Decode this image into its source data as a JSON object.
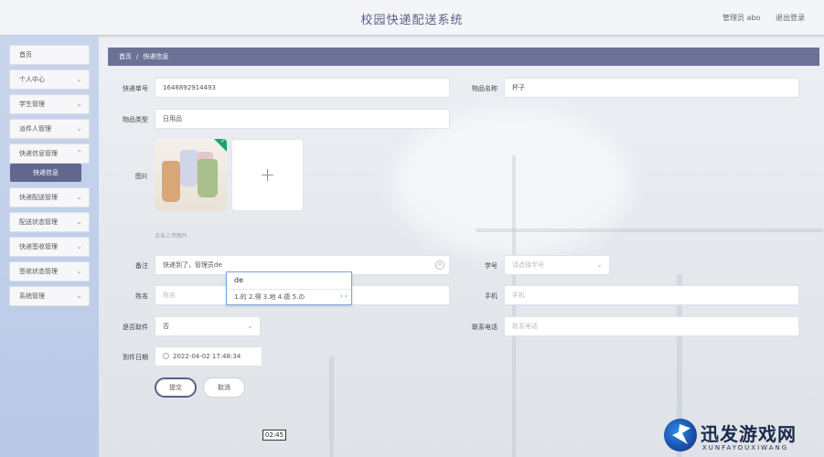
{
  "header": {
    "title": "校园快递配送系统",
    "admin": "管理员 abo",
    "logout": "退出登录"
  },
  "sidebar": {
    "items": [
      {
        "label": "首页",
        "has_chevron": false
      },
      {
        "label": "个人中心",
        "has_chevron": true
      },
      {
        "label": "学生管理",
        "has_chevron": true
      },
      {
        "label": "派件人管理",
        "has_chevron": true
      },
      {
        "label": "快递信息管理",
        "has_chevron": true
      },
      {
        "label": "快递配送管理",
        "has_chevron": true
      },
      {
        "label": "配送状态管理",
        "has_chevron": true
      },
      {
        "label": "快递签收管理",
        "has_chevron": true
      },
      {
        "label": "签收状态管理",
        "has_chevron": true
      },
      {
        "label": "系统管理",
        "has_chevron": true
      }
    ],
    "active_subitem": "快递信息"
  },
  "breadcrumb": {
    "home": "首页",
    "separator": "/",
    "current": "快递信息"
  },
  "form": {
    "tracking_no": {
      "label": "快递单号",
      "value": "1648892914493"
    },
    "item_name": {
      "label": "物品名称",
      "value": "杯子"
    },
    "item_type": {
      "label": "物品类型",
      "value": "日用品"
    },
    "image": {
      "label": "图片",
      "hint": "点击上传图片",
      "upload_symbol": "+"
    },
    "remark": {
      "label": "备注",
      "value": "快递到了，管理员de"
    },
    "student_no": {
      "label": "学号",
      "placeholder": "请选择学号"
    },
    "name": {
      "label": "姓名",
      "placeholder": "姓名"
    },
    "phone": {
      "label": "手机",
      "placeholder": "手机"
    },
    "picked_up": {
      "label": "是否取件",
      "value": "否"
    },
    "contact_phone": {
      "label": "联系电话",
      "placeholder": "联系电话"
    },
    "arrival_date": {
      "label": "到件日期",
      "value": "2022-04-02 17:48:34"
    }
  },
  "ime": {
    "composition": "de",
    "candidates": "1.的  2.得  3.地  4.德  5.の",
    "nav": "‹ ›"
  },
  "buttons": {
    "submit": "提交",
    "cancel": "取消"
  },
  "overlay": {
    "time": "02:45"
  },
  "watermark": {
    "title": "迅发游戏网",
    "subtitle": "XUNFAYOUXIWANG"
  },
  "colors": {
    "accent": "#6c7196",
    "sidebar": "#c8d5ec",
    "success": "#1aa56c"
  }
}
